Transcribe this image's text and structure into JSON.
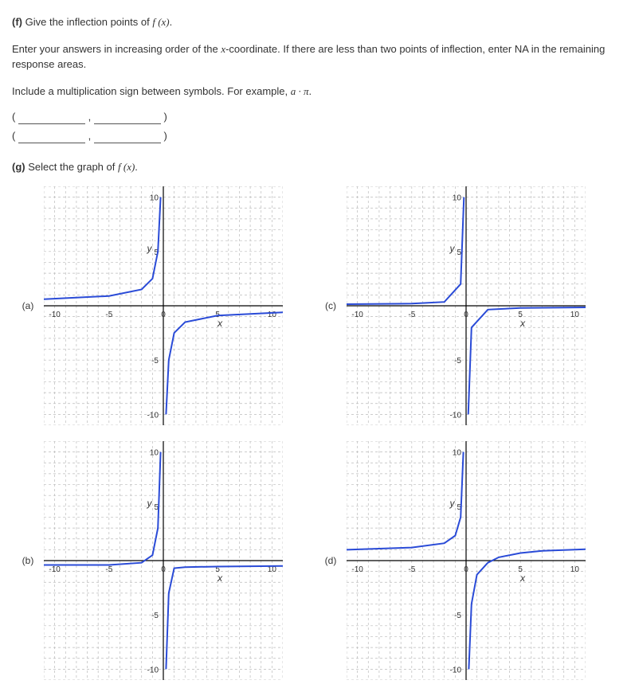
{
  "partF": {
    "label": "(f)",
    "prompt": "Give the inflection points of",
    "funcExpr": "f (x)",
    "period": ".",
    "instruction1a": "Enter your answers in increasing order of the",
    "xcoord": "x",
    "instruction1b": "-coordinate. If there are less than two points of inflection, enter NA in the remaining response areas.",
    "instruction2a": "Include a multiplication sign between symbols. For example,",
    "example": "a · π",
    "instruction2b": ".",
    "paren_open": "(",
    "paren_close": ")",
    "comma": ","
  },
  "partG": {
    "label": "(g)",
    "prompt": "Select the graph of",
    "funcExpr": "f (x)",
    "period": "."
  },
  "graphs": {
    "labels": {
      "a": "(a)",
      "b": "(b)",
      "c": "(c)",
      "d": "(d)"
    },
    "axis": {
      "ylabel": "y",
      "xlabel": "x",
      "xmin": "-10",
      "xmax": "10",
      "xmid_neg": "-5",
      "xmid_pos": "5",
      "ymin": "-10",
      "ymax": "10",
      "ymid_neg": "-5",
      "ymid_pos": "5",
      "zero": "0"
    }
  },
  "chart_data": [
    {
      "id": "a",
      "type": "line",
      "xlabel": "x",
      "ylabel": "y",
      "xlim": [
        -11,
        11
      ],
      "ylim": [
        -11,
        11
      ],
      "series": [
        {
          "name": "left_branch",
          "asymptote_side": "x<0",
          "approx_points": [
            [
              -11,
              0.6
            ],
            [
              -5,
              0.9
            ],
            [
              -2,
              1.5
            ],
            [
              -1,
              2.5
            ],
            [
              -0.5,
              5
            ],
            [
              -0.25,
              10
            ]
          ]
        },
        {
          "name": "right_branch",
          "asymptote_side": "x>0",
          "approx_points": [
            [
              0.25,
              -10
            ],
            [
              0.5,
              -5
            ],
            [
              1,
              -2.5
            ],
            [
              2,
              -1.5
            ],
            [
              5,
              -0.9
            ],
            [
              11,
              -0.6
            ]
          ]
        }
      ],
      "description": "Curve approaching y≈1 from below-left, going to +∞ as x→0−; going to −∞ as x→0+, approaching y≈−1 on right; top-left and bottom-right quadrants populated near axis."
    },
    {
      "id": "b",
      "type": "line",
      "xlabel": "x",
      "ylabel": "y",
      "xlim": [
        -11,
        11
      ],
      "ylim": [
        -11,
        11
      ],
      "series": [
        {
          "name": "left_branch",
          "approx_points": [
            [
              -11,
              -0.4
            ],
            [
              -5,
              -0.4
            ],
            [
              -2,
              -0.2
            ],
            [
              -1,
              0.5
            ],
            [
              -0.5,
              3
            ],
            [
              -0.25,
              10
            ]
          ]
        },
        {
          "name": "right_branch",
          "approx_points": [
            [
              0.25,
              -10
            ],
            [
              0.5,
              -3
            ],
            [
              1,
              -0.7
            ],
            [
              2,
              -0.6
            ],
            [
              5,
              -0.55
            ],
            [
              11,
              -0.5
            ]
          ]
        }
      ],
      "description": "Similar 1/x-type shape; left side near y≈−0.4 rising to +∞ at 0−; right side from −∞ at 0+ flattening toward y≈−0.5."
    },
    {
      "id": "c",
      "type": "line",
      "xlabel": "x",
      "ylabel": "y",
      "xlim": [
        -11,
        11
      ],
      "ylim": [
        -11,
        11
      ],
      "series": [
        {
          "name": "left_branch",
          "approx_points": [
            [
              -11,
              0.15
            ],
            [
              -5,
              0.2
            ],
            [
              -2,
              0.35
            ],
            [
              -0.5,
              2
            ],
            [
              -0.2,
              10
            ]
          ]
        },
        {
          "name": "right_branch",
          "approx_points": [
            [
              0.2,
              -10
            ],
            [
              0.5,
              -2
            ],
            [
              2,
              -0.35
            ],
            [
              5,
              -0.2
            ],
            [
              11,
              -0.15
            ]
          ]
        }
      ],
      "description": "Near-horizontal arms close to y=0; vertical asymptote at x=0; upper-left and lower-right branches."
    },
    {
      "id": "d",
      "type": "line",
      "xlabel": "x",
      "ylabel": "y",
      "xlim": [
        -11,
        11
      ],
      "ylim": [
        -11,
        11
      ],
      "series": [
        {
          "name": "left_branch",
          "approx_points": [
            [
              -11,
              1.0
            ],
            [
              -5,
              1.2
            ],
            [
              -2,
              1.6
            ],
            [
              -1,
              2.3
            ],
            [
              -0.5,
              4
            ],
            [
              -0.25,
              10
            ]
          ]
        },
        {
          "name": "right_branch",
          "approx_points": [
            [
              0.25,
              -10
            ],
            [
              0.5,
              -4
            ],
            [
              1,
              -1.3
            ],
            [
              2,
              -0.2
            ],
            [
              3,
              0.3
            ],
            [
              5,
              0.7
            ],
            [
              7,
              0.9
            ],
            [
              11,
              1.05
            ]
          ]
        }
      ],
      "description": "Left branch from y≈1 rising to +∞ at 0−; right branch from −∞ at 0+ crossing y=0 near x≈2 then approaching y≈1 from below on far right."
    }
  ]
}
